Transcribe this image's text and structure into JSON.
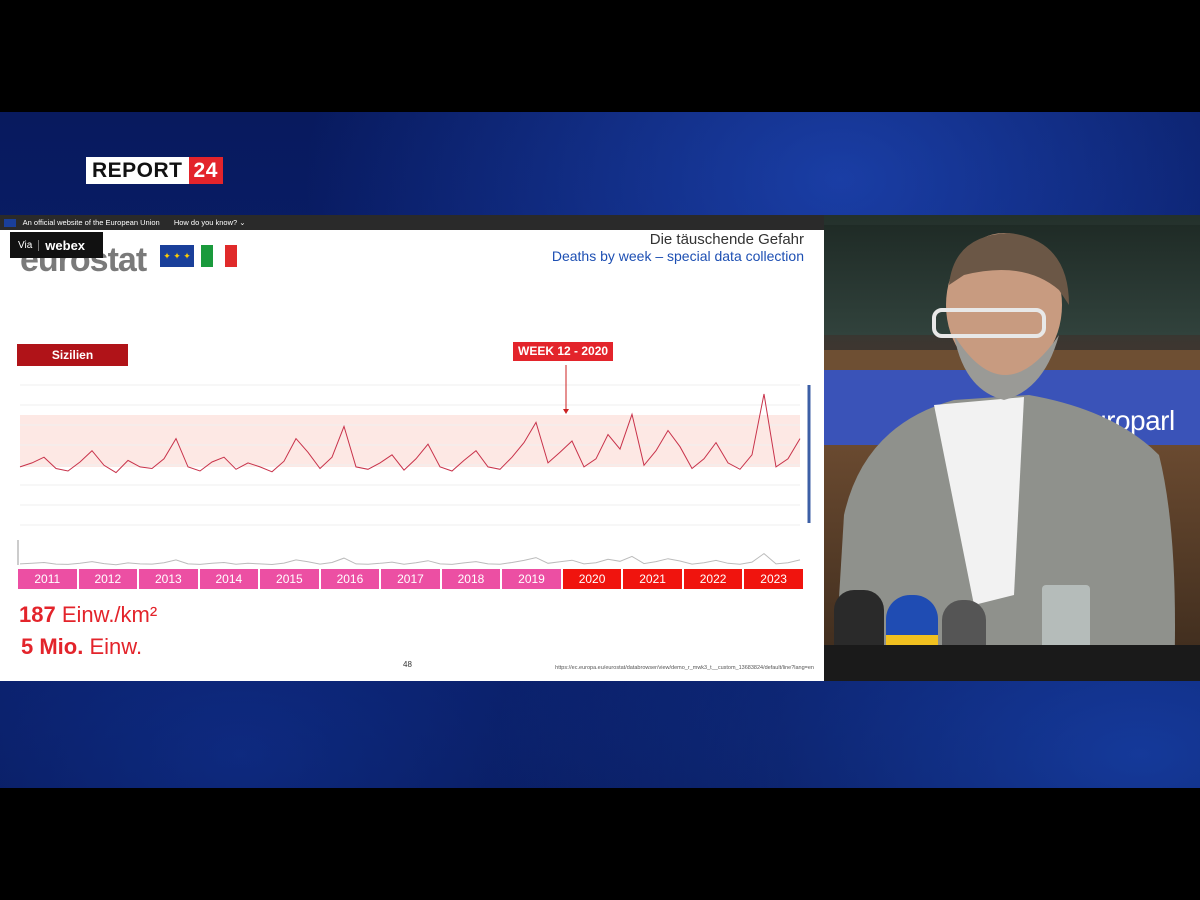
{
  "broadcast": {
    "logo_left": "REPORT",
    "logo_right": "24"
  },
  "slide": {
    "eu_banner": {
      "text": "An official website of the European Union",
      "how": "How do you know?"
    },
    "webex": {
      "via": "Via",
      "brand": "webex"
    },
    "eurostat_logo": "eurostat",
    "title": "Die täuschende Gefahr",
    "subtitle": "Deaths by week – special data collection",
    "region_label": "Sizilien",
    "annotation": "WEEK 12 - 2020",
    "years": [
      {
        "label": "2011",
        "color": "#ec4fa3"
      },
      {
        "label": "2012",
        "color": "#ec4fa3"
      },
      {
        "label": "2013",
        "color": "#ec4fa3"
      },
      {
        "label": "2014",
        "color": "#ec4fa3"
      },
      {
        "label": "2015",
        "color": "#ec4fa3"
      },
      {
        "label": "2016",
        "color": "#ec4fa3"
      },
      {
        "label": "2017",
        "color": "#ec4fa3"
      },
      {
        "label": "2018",
        "color": "#ec4fa3"
      },
      {
        "label": "2019",
        "color": "#ec4fa3"
      },
      {
        "label": "2020",
        "color": "#f0140e"
      },
      {
        "label": "2021",
        "color": "#f0140e"
      },
      {
        "label": "2022",
        "color": "#f0140e"
      },
      {
        "label": "2023",
        "color": "#f0140e"
      }
    ],
    "density_value": "187",
    "density_unit": "Einw./km²",
    "population_value": "5 Mio.",
    "population_unit": "Einw.",
    "page_number": "48",
    "source_url": "https://ec.europa.eu/eurostat/databrowser/view/demo_r_mwk3_t__custom_13683824/default/line?lang=en"
  },
  "camera": {
    "banner_text": "europarl"
  },
  "colors": {
    "band_fill": "#fde8e4",
    "line": "#c8324a",
    "marker": "#cc2222",
    "scroll": "#3c5fa6"
  },
  "chart_data": {
    "type": "line",
    "x_range": [
      "2011-W01",
      "2023-W52"
    ],
    "series": [
      {
        "values": [
          1.0,
          1.05,
          1.12,
          0.98,
          0.95,
          1.06,
          1.2,
          1.02,
          0.93,
          1.08,
          1.0,
          0.98,
          1.1,
          1.35,
          1.0,
          0.95,
          1.06,
          1.12,
          0.97,
          1.05,
          1.0,
          0.94,
          1.07,
          1.35,
          1.18,
          0.98,
          1.12,
          1.5,
          1.0,
          0.97,
          1.05,
          1.15,
          0.96,
          1.1,
          1.28,
          1.0,
          0.95,
          1.08,
          1.2,
          1.0,
          0.97,
          1.12,
          1.3,
          1.55,
          1.05,
          1.18,
          1.32,
          1.0,
          1.1,
          1.4,
          1.22,
          1.65,
          1.02,
          1.2,
          1.45,
          1.25,
          0.98,
          1.1,
          1.3,
          1.05,
          0.97,
          1.15,
          1.9,
          1.0,
          1.1,
          1.35
        ]
      }
    ]
  }
}
